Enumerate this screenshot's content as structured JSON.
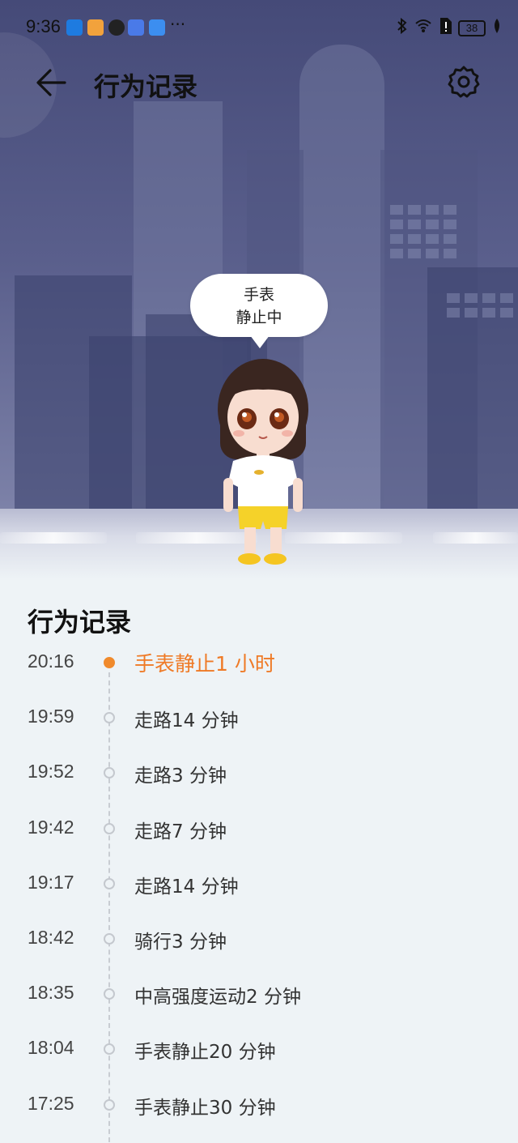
{
  "status_bar": {
    "time": "9:36",
    "more": "···",
    "battery": "38"
  },
  "header": {
    "title": "行为记录"
  },
  "bubble": {
    "line1": "手表",
    "line2": "静止中"
  },
  "records": {
    "title": "行为记录",
    "items": [
      {
        "time": "20:16",
        "text": "手表静止1 小时",
        "active": true
      },
      {
        "time": "19:59",
        "text": "走路14 分钟"
      },
      {
        "time": "19:52",
        "text": "走路3 分钟"
      },
      {
        "time": "19:42",
        "text": "走路7 分钟"
      },
      {
        "time": "19:17",
        "text": "走路14 分钟"
      },
      {
        "time": "18:42",
        "text": "骑行3 分钟"
      },
      {
        "time": "18:35",
        "text": "中高强度运动2 分钟"
      },
      {
        "time": "18:04",
        "text": "手表静止20 分钟"
      },
      {
        "time": "17:25",
        "text": "手表静止30 分钟"
      }
    ]
  },
  "colors": {
    "accent": "#ef7a26",
    "sky": "#454a78"
  }
}
